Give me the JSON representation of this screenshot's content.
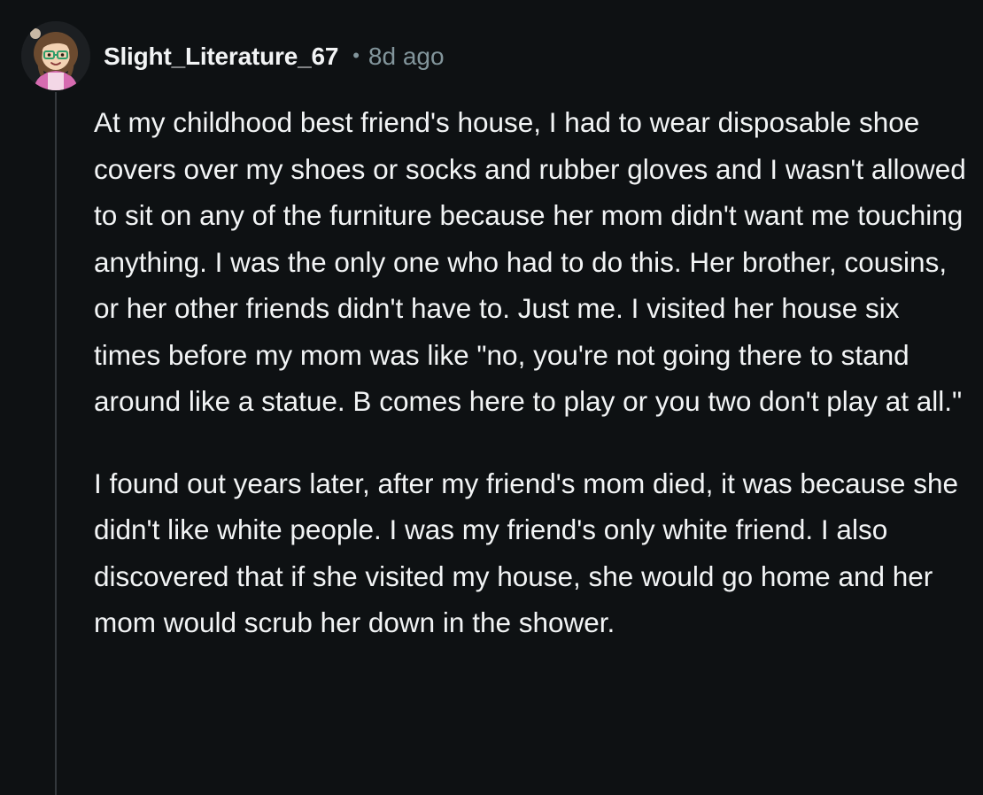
{
  "comment": {
    "author": "Slight_Literature_67",
    "separator": "•",
    "timestamp": "8d ago",
    "avatar_icon": "user-avatar-icon",
    "paragraphs": [
      "At my childhood best friend's house, I had to wear disposable shoe covers over my shoes or socks and rubber gloves and I wasn't allowed to sit on any of the furniture because her mom didn't want me touching anything. I was the only one who had to do this. Her brother, cousins, or her other friends didn't have to. Just me. I visited her house six times before my mom was like \"no, you're not going there to stand around like a statue. B comes here to play or you two don't play at all.\"",
      "I found out years later, after my friend's mom died, it was because she didn't like white people. I was my friend's only white friend. I also discovered that if she visited my house, she would go home and her mom would scrub her down in the shower."
    ]
  },
  "colors": {
    "background": "#0e1113",
    "text": "#f2f4f5",
    "muted": "#82959b",
    "thread_line": "#33383c"
  }
}
